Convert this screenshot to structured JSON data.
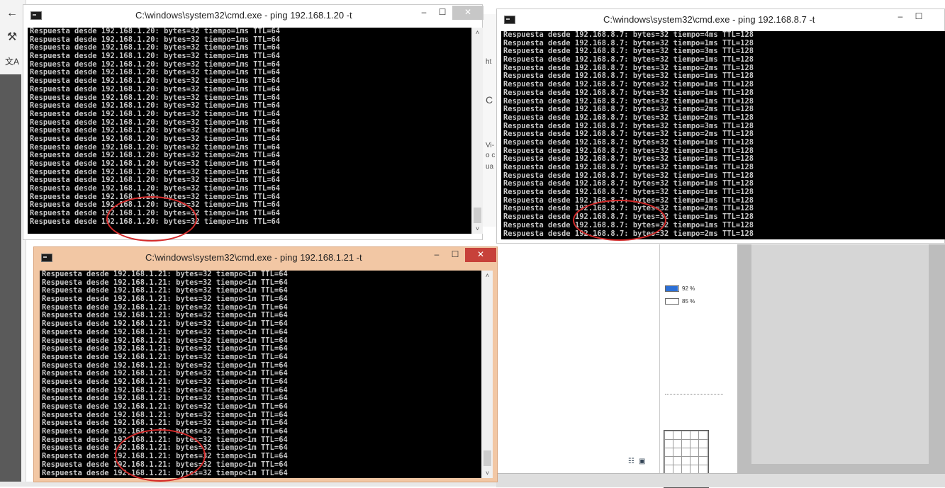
{
  "windows": [
    {
      "id": "ping-20",
      "title": "C:\\windows\\system32\\cmd.exe - ping  192.168.1.20 -t",
      "active": false,
      "lines": [
        "Respuesta desde 192.168.1.20: bytes=32 tiempo=1ms TTL=64",
        "Respuesta desde 192.168.1.20: bytes=32 tiempo=1ms TTL=64",
        "Respuesta desde 192.168.1.20: bytes=32 tiempo=1ms TTL=64",
        "Respuesta desde 192.168.1.20: bytes=32 tiempo=1ms TTL=64",
        "Respuesta desde 192.168.1.20: bytes=32 tiempo=1ms TTL=64",
        "Respuesta desde 192.168.1.20: bytes=32 tiempo=1ms TTL=64",
        "Respuesta desde 192.168.1.20: bytes=32 tiempo=1ms TTL=64",
        "Respuesta desde 192.168.1.20: bytes=32 tiempo=1ms TTL=64",
        "Respuesta desde 192.168.1.20: bytes=32 tiempo=1ms TTL=64",
        "Respuesta desde 192.168.1.20: bytes=32 tiempo=1ms TTL=64",
        "Respuesta desde 192.168.1.20: bytes=32 tiempo=1ms TTL=64",
        "Respuesta desde 192.168.1.20: bytes=32 tiempo=1ms TTL=64",
        "Respuesta desde 192.168.1.20: bytes=32 tiempo=1ms TTL=64",
        "Respuesta desde 192.168.1.20: bytes=32 tiempo=1ms TTL=64",
        "Respuesta desde 192.168.1.20: bytes=32 tiempo=1ms TTL=64",
        "Respuesta desde 192.168.1.20: bytes=32 tiempo=2ms TTL=64",
        "Respuesta desde 192.168.1.20: bytes=32 tiempo=1ms TTL=64",
        "Respuesta desde 192.168.1.20: bytes=32 tiempo=1ms TTL=64",
        "Respuesta desde 192.168.1.20: bytes=32 tiempo=1ms TTL=64",
        "Respuesta desde 192.168.1.20: bytes=32 tiempo=1ms TTL=64",
        "Respuesta desde 192.168.1.20: bytes=32 tiempo=1ms TTL=64",
        "Respuesta desde 192.168.1.20: bytes=32 tiempo=1ms TTL=64",
        "Respuesta desde 192.168.1.20: bytes=32 tiempo=1ms TTL=64",
        "Respuesta desde 192.168.1.20: bytes=32 tiempo=1ms TTL=64"
      ]
    },
    {
      "id": "ping-8-7",
      "title": "C:\\windows\\system32\\cmd.exe - ping  192.168.8.7 -t",
      "active": false,
      "lines": [
        "Respuesta desde 192.168.8.7: bytes=32 tiempo=4ms TTL=128",
        "Respuesta desde 192.168.8.7: bytes=32 tiempo=1ms TTL=128",
        "Respuesta desde 192.168.8.7: bytes=32 tiempo=3ms TTL=128",
        "Respuesta desde 192.168.8.7: bytes=32 tiempo=1ms TTL=128",
        "Respuesta desde 192.168.8.7: bytes=32 tiempo=2ms TTL=128",
        "Respuesta desde 192.168.8.7: bytes=32 tiempo=1ms TTL=128",
        "Respuesta desde 192.168.8.7: bytes=32 tiempo=1ms TTL=128",
        "Respuesta desde 192.168.8.7: bytes=32 tiempo=1ms TTL=128",
        "Respuesta desde 192.168.8.7: bytes=32 tiempo=1ms TTL=128",
        "Respuesta desde 192.168.8.7: bytes=32 tiempo=2ms TTL=128",
        "Respuesta desde 192.168.8.7: bytes=32 tiempo=2ms TTL=128",
        "Respuesta desde 192.168.8.7: bytes=32 tiempo=3ms TTL=128",
        "Respuesta desde 192.168.8.7: bytes=32 tiempo=2ms TTL=128",
        "Respuesta desde 192.168.8.7: bytes=32 tiempo=1ms TTL=128",
        "Respuesta desde 192.168.8.7: bytes=32 tiempo=1ms TTL=128",
        "Respuesta desde 192.168.8.7: bytes=32 tiempo=1ms TTL=128",
        "Respuesta desde 192.168.8.7: bytes=32 tiempo=1ms TTL=128",
        "Respuesta desde 192.168.8.7: bytes=32 tiempo=1ms TTL=128",
        "Respuesta desde 192.168.8.7: bytes=32 tiempo=1ms TTL=128",
        "Respuesta desde 192.168.8.7: bytes=32 tiempo=1ms TTL=128",
        "Respuesta desde 192.168.8.7: bytes=32 tiempo=1ms TTL=128",
        "Respuesta desde 192.168.8.7: bytes=32 tiempo=2ms TTL=128",
        "Respuesta desde 192.168.8.7: bytes=32 tiempo=1ms TTL=128",
        "Respuesta desde 192.168.8.7: bytes=32 tiempo=1ms TTL=128",
        "Respuesta desde 192.168.8.7: bytes=32 tiempo=2ms TTL=128"
      ]
    },
    {
      "id": "ping-21",
      "title": "C:\\windows\\system32\\cmd.exe - ping  192.168.1.21 -t",
      "active": true,
      "lines": [
        "Respuesta desde 192.168.1.21: bytes=32 tiempo<1m TTL=64",
        "Respuesta desde 192.168.1.21: bytes=32 tiempo<1m TTL=64",
        "Respuesta desde 192.168.1.21: bytes=32 tiempo<1m TTL=64",
        "Respuesta desde 192.168.1.21: bytes=32 tiempo<1m TTL=64",
        "Respuesta desde 192.168.1.21: bytes=32 tiempo<1m TTL=64",
        "Respuesta desde 192.168.1.21: bytes=32 tiempo<1m TTL=64",
        "Respuesta desde 192.168.1.21: bytes=32 tiempo<1m TTL=64",
        "Respuesta desde 192.168.1.21: bytes=32 tiempo<1m TTL=64",
        "Respuesta desde 192.168.1.21: bytes=32 tiempo<1m TTL=64",
        "Respuesta desde 192.168.1.21: bytes=32 tiempo<1m TTL=64",
        "Respuesta desde 192.168.1.21: bytes=32 tiempo<1m TTL=64",
        "Respuesta desde 192.168.1.21: bytes=32 tiempo<1m TTL=64",
        "Respuesta desde 192.168.1.21: bytes=32 tiempo<1m TTL=64",
        "Respuesta desde 192.168.1.21: bytes=32 tiempo<1m TTL=64",
        "Respuesta desde 192.168.1.21: bytes=32 tiempo<1m TTL=64",
        "Respuesta desde 192.168.1.21: bytes=32 tiempo<1m TTL=64",
        "Respuesta desde 192.168.1.21: bytes=32 tiempo<1m TTL=64",
        "Respuesta desde 192.168.1.21: bytes=32 tiempo<1m TTL=64",
        "Respuesta desde 192.168.1.21: bytes=32 tiempo<1m TTL=64",
        "Respuesta desde 192.168.1.21: bytes=32 tiempo<1m TTL=64",
        "Respuesta desde 192.168.1.21: bytes=32 tiempo<1m TTL=64",
        "Respuesta desde 192.168.1.21: bytes=32 tiempo<1m TTL=64",
        "Respuesta desde 192.168.1.21: bytes=32 tiempo<1m TTL=64",
        "Respuesta desde 192.168.1.21: bytes=32 tiempo<1m TTL=64",
        "Respuesta desde 192.168.1.21: bytes=32 tiempo<1m TTL=64"
      ]
    }
  ],
  "window_buttons": {
    "minimize": "–",
    "maximize": "☐",
    "close": "✕"
  },
  "scroll_arrows": {
    "up": "˄",
    "down": "˅"
  },
  "background": {
    "percent_rows": [
      {
        "label": "92 %",
        "fill": 0.92
      },
      {
        "label": "85 %",
        "fill": 0.85
      }
    ],
    "fragments": [
      "ht",
      "C",
      "Vi-",
      "o c",
      "ua"
    ],
    "toolbar_icons": [
      "back-arrow-icon",
      "paintbrush-icon",
      "translate-icon"
    ]
  },
  "colors": {
    "console_bg": "#000000",
    "console_text": "#c8c8c8",
    "active_frame": "#f2c7a4",
    "inactive_frame": "#ffffff",
    "close_inactive": "#c7c7c7",
    "close_active": "#c7413a",
    "highlight_circle": "#d42a2a"
  }
}
